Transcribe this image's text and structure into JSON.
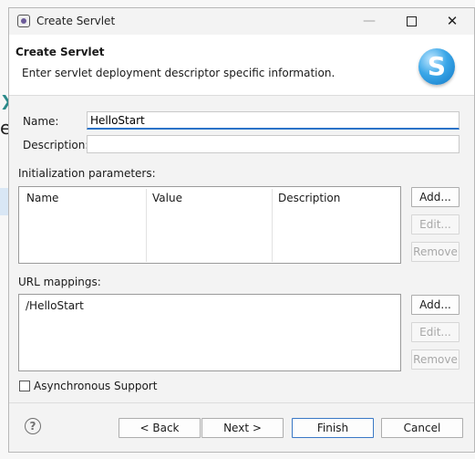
{
  "window": {
    "title": "Create Servlet"
  },
  "header": {
    "title": "Create Servlet",
    "description": "Enter servlet deployment descriptor specific information.",
    "logo_letter": "S"
  },
  "background": {
    "letter": "e"
  },
  "fields": {
    "name_label": "Name:",
    "name_value": "HelloStart",
    "description_label": "Description:",
    "description_value": ""
  },
  "init_params": {
    "label": "Initialization parameters:",
    "columns": [
      "Name",
      "Value",
      "Description"
    ],
    "buttons": {
      "add": "Add...",
      "edit": "Edit...",
      "remove": "Remove"
    }
  },
  "url_mappings": {
    "label": "URL mappings:",
    "items": [
      "/HelloStart"
    ],
    "buttons": {
      "add": "Add...",
      "edit": "Edit...",
      "remove": "Remove"
    }
  },
  "async": {
    "label": "Asynchronous Support",
    "checked": false
  },
  "footer": {
    "back": "< Back",
    "next": "Next >",
    "finish": "Finish",
    "cancel": "Cancel"
  }
}
